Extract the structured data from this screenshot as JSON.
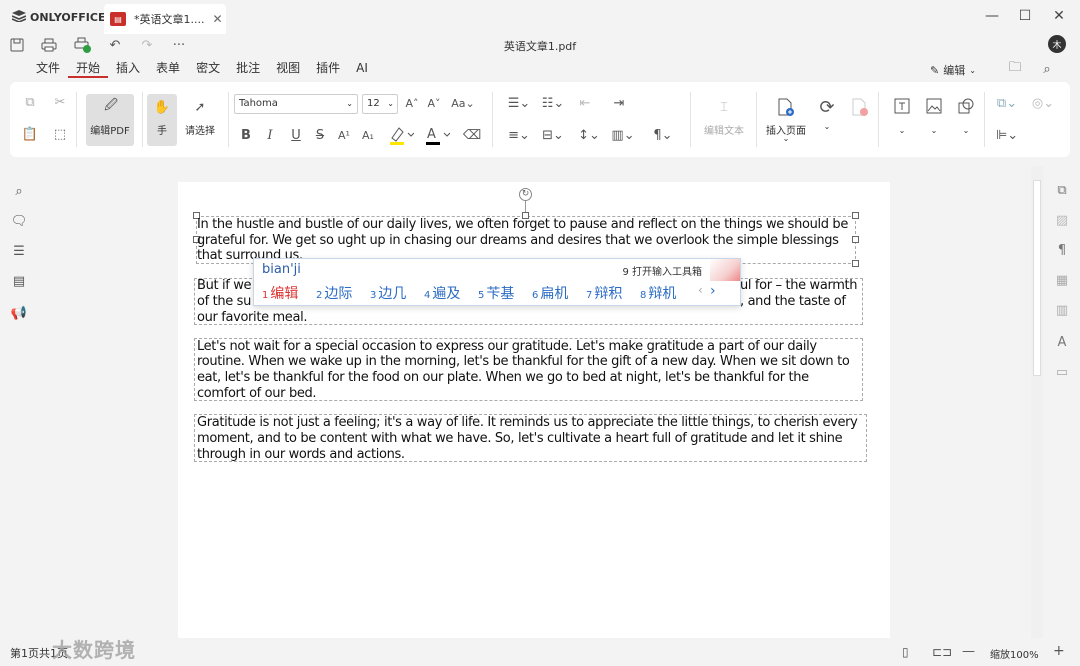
{
  "app": {
    "brand": "ONLYOFFICE",
    "doc_tab": "*英语文章1....",
    "file_badge": "PDF",
    "filename": "英语文章1.pdf",
    "avatar": "木"
  },
  "menu": {
    "tabs": [
      "文件",
      "开始",
      "插入",
      "表单",
      "密文",
      "批注",
      "视图",
      "插件",
      "AI"
    ],
    "active": "开始",
    "edit_label": "编辑"
  },
  "toolbar": {
    "edit_pdf": "编辑PDF",
    "hand": "手",
    "select": "请选择",
    "font": "Tahoma",
    "size": "12",
    "edit_text": "编辑文本",
    "insert_page": "插入页面"
  },
  "document": {
    "paragraphs": [
      "In the hustle and bustle of our daily lives, we often forget to pause and reflect on the things we should be grateful for. We get so ught up in chasing our dreams and desires that we overlook the simple blessings that surround us.",
      "But if we ... the warmth of the su... and the taste of our favorite meal.",
      "Let's not wait for a special occasion to express our gratitude. Let's make gratitude a part of our daily routine. When we wake up in the morning, let's be thankful for the gift of a new day. When we sit down to eat, let's be thankful for the food on our plate. When we go to bed at night, let's be thankful for the comfort of our bed.",
      "Gratitude is not just a feeling; it's a way of life. It reminds us to appreciate the little things, to cherish every moment, and to be content with what we have. So, let's cultivate a heart full of gratitude and let it shine through in our words and actions."
    ],
    "p1_lines": [
      "In the hustle and bustle of our daily lives, we often forget to pause and reflect on the things we should be",
      "grateful for. We get so ught up in chasing our dreams and desires that we overlook the simple blessings",
      "that surround us."
    ],
    "p2_lines": [
      "But if we",
      "ul for – the warmth",
      "of the su",
      ", and the taste of",
      "our favorite meal."
    ],
    "p3_lines": [
      "Let's not wait for a special occasion to express our gratitude. Let's make gratitude a part of our daily",
      "routine. When we wake up in the morning, let's be thankful for the gift of a new day. When we sit down to",
      "eat, let's be thankful for the food on our plate. When we go to bed at night, let's be thankful for the",
      "comfort of our bed."
    ],
    "p4_lines": [
      "Gratitude is not just a feeling; it's a way of life. It reminds us to appreciate the little things, to cherish every",
      "moment, and to be content with what we have. So, let's cultivate a heart full of gratitude and let it shine",
      "through in our words and actions."
    ]
  },
  "ime": {
    "code": "bian'ji",
    "tool_label": "9 打开输入工具箱",
    "candidates": [
      {
        "n": "1",
        "text": "编辑"
      },
      {
        "n": "2",
        "text": "边际"
      },
      {
        "n": "3",
        "text": "边几"
      },
      {
        "n": "4",
        "text": "遍及"
      },
      {
        "n": "5",
        "text": "苄基"
      },
      {
        "n": "6",
        "text": "扁机"
      },
      {
        "n": "7",
        "text": "辩积"
      },
      {
        "n": "8",
        "text": "辩机"
      }
    ]
  },
  "status": {
    "page_info": "第1页共1页",
    "zoom": "缩放100%",
    "watermark": "大数跨境"
  },
  "icons": [
    "save-icon",
    "print-icon",
    "quick-print-icon",
    "undo-icon",
    "redo-icon",
    "more-icon",
    "search-icon",
    "comment-icon",
    "headings-icon",
    "thumbnails-icon",
    "feedback-icon"
  ],
  "colors": {
    "accent": "#c9302c",
    "ime_text": "#2b6cc4",
    "ime_first": "#dd3333"
  }
}
